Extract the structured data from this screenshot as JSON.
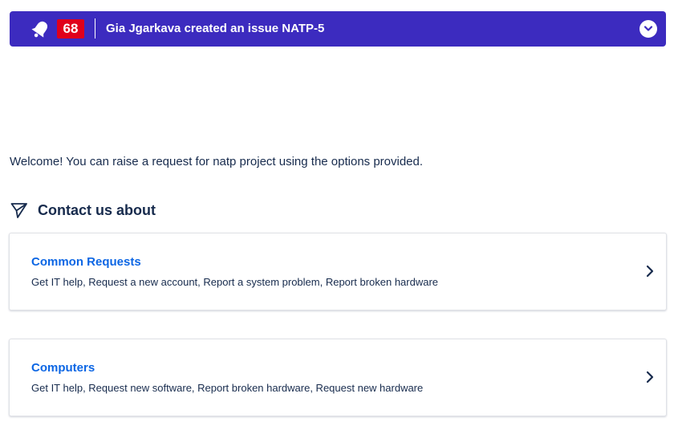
{
  "notification": {
    "count": "68",
    "message": "Gia Jgarkava created an issue NATP-5",
    "bar_color": "#3c2bbf",
    "badge_color": "#e0001b",
    "bell_icon": "bell-icon",
    "expand_icon": "chevron-down-icon"
  },
  "welcome": {
    "text": "Welcome! You can raise a request for natp project using the options provided."
  },
  "contact": {
    "heading": "Contact us about",
    "icon": "send-icon"
  },
  "request_groups": [
    {
      "title": "Common Requests",
      "description": "Get IT help, Request a new account, Report a system problem, Report broken hardware"
    },
    {
      "title": "Computers",
      "description": "Get IT help, Request new software, Report broken hardware, Request new hardware"
    }
  ],
  "colors": {
    "link": "#0c66e4",
    "text": "#172b4d"
  }
}
